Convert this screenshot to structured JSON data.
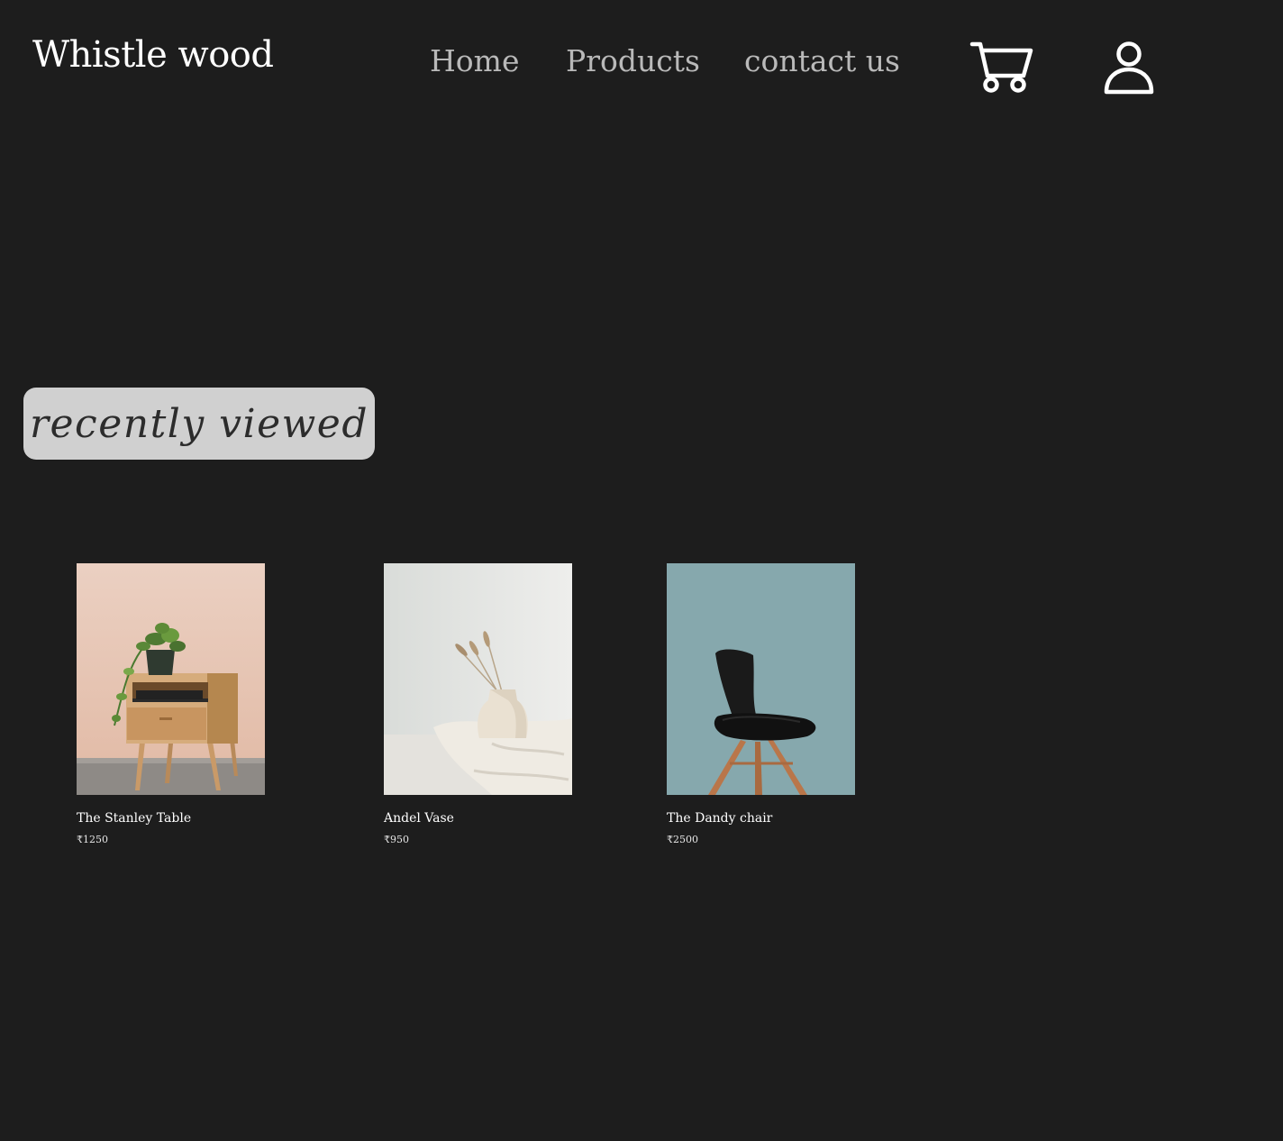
{
  "header": {
    "brand": "Whistle wood",
    "nav": {
      "home": "Home",
      "products": "Products",
      "contact": "contact us"
    },
    "icons": {
      "cart": "cart-icon",
      "account": "user-icon"
    }
  },
  "section": {
    "title": "recently viewed"
  },
  "products": [
    {
      "name": "The Stanley Table",
      "price": "₹1250"
    },
    {
      "name": "Andel Vase",
      "price": "₹950"
    },
    {
      "name": "The Dandy chair",
      "price": "₹2500"
    }
  ],
  "colors": {
    "background": "#1d1d1d",
    "brand_text": "#ffffff",
    "nav_text": "#b9b9b9",
    "badge_bg": "#d0d0d0",
    "badge_text": "#2c2c2c"
  }
}
